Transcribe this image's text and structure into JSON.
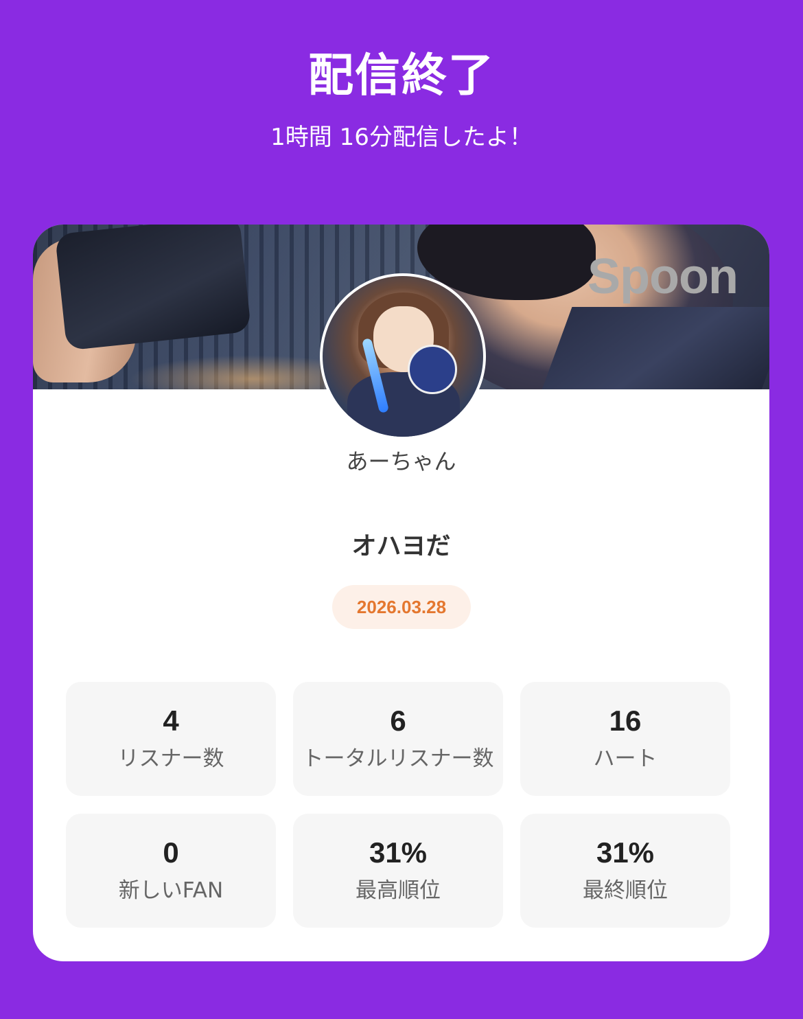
{
  "header": {
    "title": "配信終了",
    "subtitle": "1時間 16分配信したよ！"
  },
  "card": {
    "brand_logo": "Spoon",
    "username": "あーちゃん",
    "stream_title": "オハヨだ",
    "date": "2026.03.28"
  },
  "stats": [
    {
      "value": "4",
      "label": "リスナー数"
    },
    {
      "value": "6",
      "label": "トータルリスナー数"
    },
    {
      "value": "16",
      "label": "ハート"
    },
    {
      "value": "0",
      "label": "新しいFAN"
    },
    {
      "value": "31%",
      "label": "最高順位"
    },
    {
      "value": "31%",
      "label": "最終順位"
    }
  ],
  "colors": {
    "background": "#8a2be2",
    "date_text": "#e4772f",
    "date_bg": "#fdf0e8"
  }
}
